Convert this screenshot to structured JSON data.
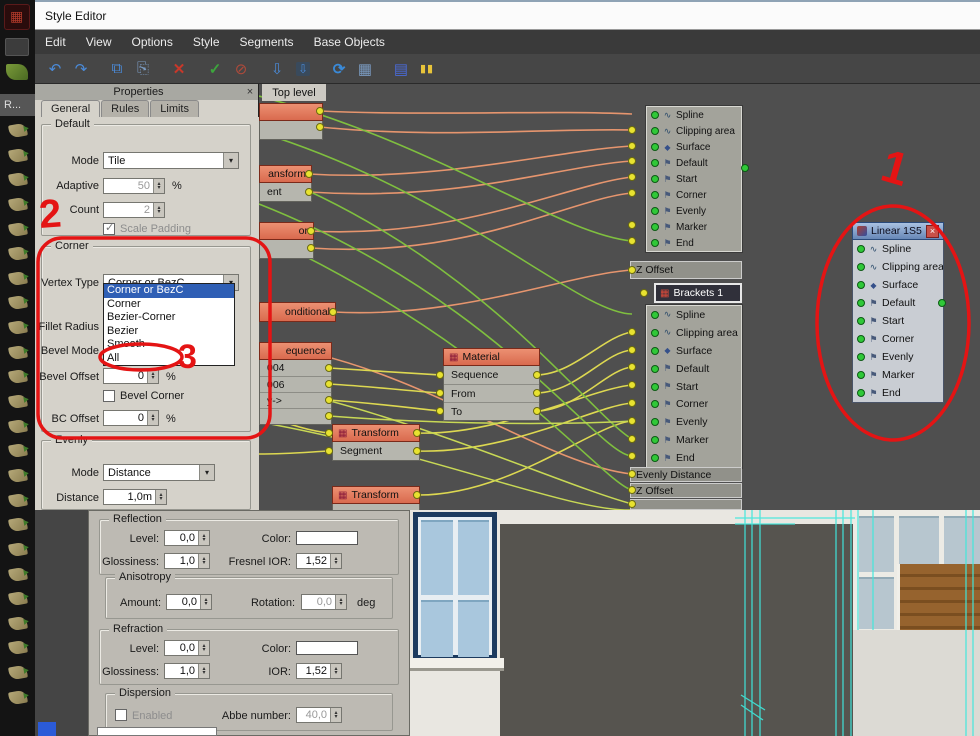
{
  "window": {
    "title": "Style Editor"
  },
  "left_rail": {
    "r_label": "R..."
  },
  "menu": {
    "items": [
      "Edit",
      "View",
      "Options",
      "Style",
      "Segments",
      "Base Objects"
    ]
  },
  "toolbar": {
    "icons": [
      "undo",
      "redo",
      "copy",
      "paste",
      "delete",
      "apply",
      "record",
      "filter-down",
      "filter-box",
      "refresh",
      "table",
      "notes",
      "pause"
    ]
  },
  "properties": {
    "title": "Properties",
    "close_label": "×",
    "tabs": [
      "General",
      "Rules",
      "Limits"
    ],
    "default_group": {
      "label": "Default",
      "mode_label": "Mode",
      "mode_value": "Tile",
      "adaptive_label": "Adaptive",
      "adaptive_value": "50",
      "adaptive_unit": "%",
      "count_label": "Count",
      "count_value": "2",
      "scale_padding_label": "Scale Padding"
    },
    "corner_group": {
      "label": "Corner",
      "vertex_type_label": "Vertex Type",
      "vertex_type_value": "Corner or BezC",
      "options": [
        "Corner or BezC",
        "Corner",
        "Bezier-Corner",
        "Bezier",
        "Smooth",
        "All"
      ],
      "fillet_radius_label": "Fillet Radius",
      "bevel_mode_label": "Bevel Mode",
      "bevel_offset_label": "Bevel Offset",
      "bevel_offset_value": "0",
      "bevel_offset_unit": "%",
      "bevel_corner_label": "Bevel Corner",
      "bc_offset_label": "BC Offset",
      "bc_offset_value": "0",
      "bc_offset_unit": "%"
    },
    "evenly_group": {
      "label": "Evenly",
      "mode_label": "Mode",
      "mode_value": "Distance",
      "distance_label": "Distance",
      "distance_value": "1,0m"
    }
  },
  "node_canvas": {
    "tab_label": "Top level",
    "socket_items": [
      "Spline",
      "Clipping area",
      "Surface",
      "Default",
      "Start",
      "Corner",
      "Evenly",
      "Marker",
      "End"
    ],
    "bars": {
      "z_offset": "Z Offset",
      "brackets": "Brackets 1",
      "evenly_distance": "Evenly Distance",
      "z_offset_2": "Z Offset"
    },
    "material_node": {
      "title": "Material",
      "rows": [
        "Sequence",
        "From",
        "To"
      ]
    },
    "transform_node_1": {
      "title": "Transform",
      "row": "Segment"
    },
    "transform_node_2": {
      "title": "Transform"
    },
    "partial_nodes": {
      "p1_row": "ent",
      "p1_head": "ansform",
      "p2_head": "or",
      "p3_head": "onditional",
      "p4_head": "equence",
      "p4_rows": [
        "004",
        "006",
        "y->"
      ]
    },
    "linear_node": {
      "title": "Linear 1S5",
      "close_label": "×"
    }
  },
  "material_editor": {
    "reflection": {
      "label": "Reflection",
      "level_label": "Level:",
      "level_value": "0,0",
      "color_label": "Color:",
      "gloss_label": "Glossiness:",
      "gloss_value": "1,0",
      "fresnel_label": "Fresnel IOR:",
      "fresnel_value": "1,52"
    },
    "anisotropy": {
      "label": "Anisotropy",
      "amount_label": "Amount:",
      "amount_value": "0,0",
      "rotation_label": "Rotation:",
      "rotation_value": "0,0",
      "deg_label": "deg"
    },
    "refraction": {
      "label": "Refraction",
      "level_label": "Level:",
      "level_value": "0,0",
      "color_label": "Color:",
      "gloss_label": "Glossiness:",
      "gloss_value": "1,0",
      "ior_label": "IOR:",
      "ior_value": "1,52"
    },
    "dispersion": {
      "label": "Dispersion",
      "enabled_label": "Enabled",
      "abbe_label": "Abbe number:",
      "abbe_value": "40,0"
    }
  },
  "annotations": {
    "step_1": "1",
    "step_2": "2",
    "step_3": "3"
  }
}
